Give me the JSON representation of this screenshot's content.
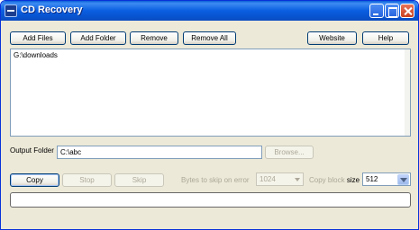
{
  "window": {
    "title": "CD Recovery",
    "controls": {
      "minimize": "minimize",
      "maximize": "maximize",
      "close": "close"
    }
  },
  "toolbar": {
    "add_files": "Add Files",
    "add_folder": "Add Folder",
    "remove": "Remove",
    "remove_all": "Remove All",
    "website": "Website",
    "help": "Help"
  },
  "source_list": {
    "items": [
      "G:\\downloads"
    ]
  },
  "output": {
    "label": "Output Folder",
    "value": "C:\\abc",
    "browse": "Browse..."
  },
  "actions": {
    "copy": "Copy",
    "stop": "Stop",
    "skip": "Skip"
  },
  "options": {
    "bytes_to_skip_label": "Bytes to skip on error",
    "bytes_to_skip_value": "1024",
    "copy_block_label": "Copy block",
    "copy_block_label_suffix": "size",
    "copy_block_value": "512"
  },
  "progress": {
    "value": 0
  },
  "colors": {
    "titlebar": "#0a5ee0",
    "window_bg": "#ece9d8",
    "progress_fill": "#2fb42f"
  }
}
